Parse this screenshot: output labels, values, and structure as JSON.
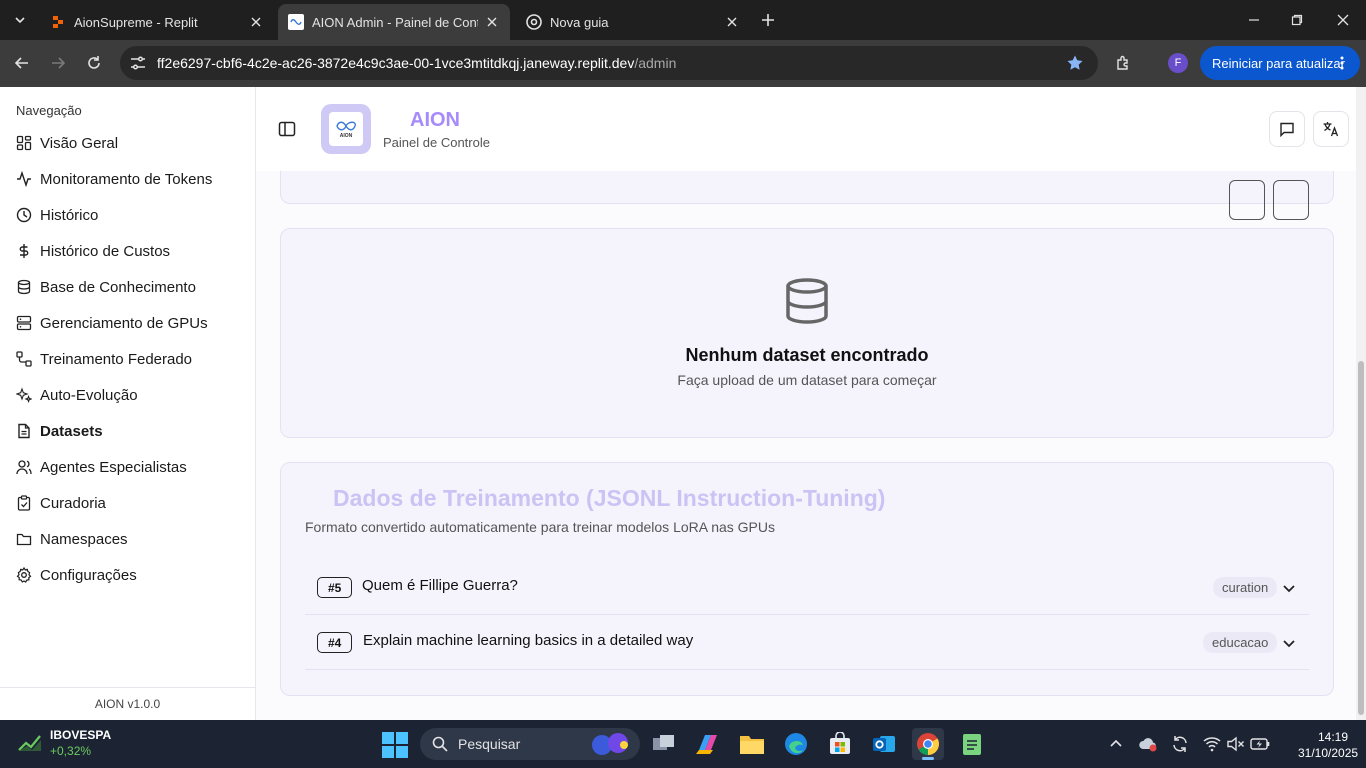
{
  "browser": {
    "tabs": [
      {
        "label": "AionSupreme - Replit"
      },
      {
        "label": "AION Admin - Painel de Controle"
      },
      {
        "label": "Nova guia"
      }
    ],
    "url_host": "ff2e6297-cbf6-4c2e-ac26-3872e4c9c3ae-00-1vce3mtitdkqj.janeway.replit.dev",
    "url_path": "/admin",
    "profile_initial": "F",
    "update_label": "Reiniciar para atualizar"
  },
  "sidebar": {
    "title": "Navegação",
    "items": [
      {
        "label": "Visão Geral",
        "icon": "grid-icon"
      },
      {
        "label": "Monitoramento de Tokens",
        "icon": "activity-icon"
      },
      {
        "label": "Histórico",
        "icon": "clock-icon"
      },
      {
        "label": "Histórico de Custos",
        "icon": "dollar-icon"
      },
      {
        "label": "Base de Conhecimento",
        "icon": "database-icon"
      },
      {
        "label": "Gerenciamento de GPUs",
        "icon": "server-icon"
      },
      {
        "label": "Treinamento Federado",
        "icon": "network-icon"
      },
      {
        "label": "Auto-Evolução",
        "icon": "sparkles-icon"
      },
      {
        "label": "Datasets",
        "icon": "file-icon",
        "active": true
      },
      {
        "label": "Agentes Especialistas",
        "icon": "users-icon"
      },
      {
        "label": "Curadoria",
        "icon": "clipboard-check-icon"
      },
      {
        "label": "Namespaces",
        "icon": "folder-icon"
      },
      {
        "label": "Configurações",
        "icon": "gear-icon"
      }
    ],
    "version": "AION v1.0.0"
  },
  "header": {
    "brand": "AION",
    "subtitle": "Painel de Controle",
    "logo_text": "AION"
  },
  "empty_state": {
    "title": "Nenhum dataset encontrado",
    "subtitle": "Faça upload de um dataset para começar"
  },
  "training": {
    "title": "Dados de Treinamento (JSONL Instruction-Tuning)",
    "subtitle": "Formato convertido automaticamente para treinar modelos LoRA nas GPUs",
    "rows": [
      {
        "id": "#5",
        "question": "Quem é Fillipe Guerra?",
        "tag": "curation"
      },
      {
        "id": "#4",
        "question": "Explain machine learning basics in a detailed way",
        "tag": "educacao"
      }
    ]
  },
  "taskbar": {
    "stock_name": "IBOVESPA",
    "stock_change": "+0,32%",
    "search_placeholder": "Pesquisar",
    "time": "14:19",
    "date": "31/10/2025"
  },
  "colors": {
    "accent": "#a78bfa",
    "update_button": "#0b57d0",
    "card_bg": "#f5f4fd"
  }
}
